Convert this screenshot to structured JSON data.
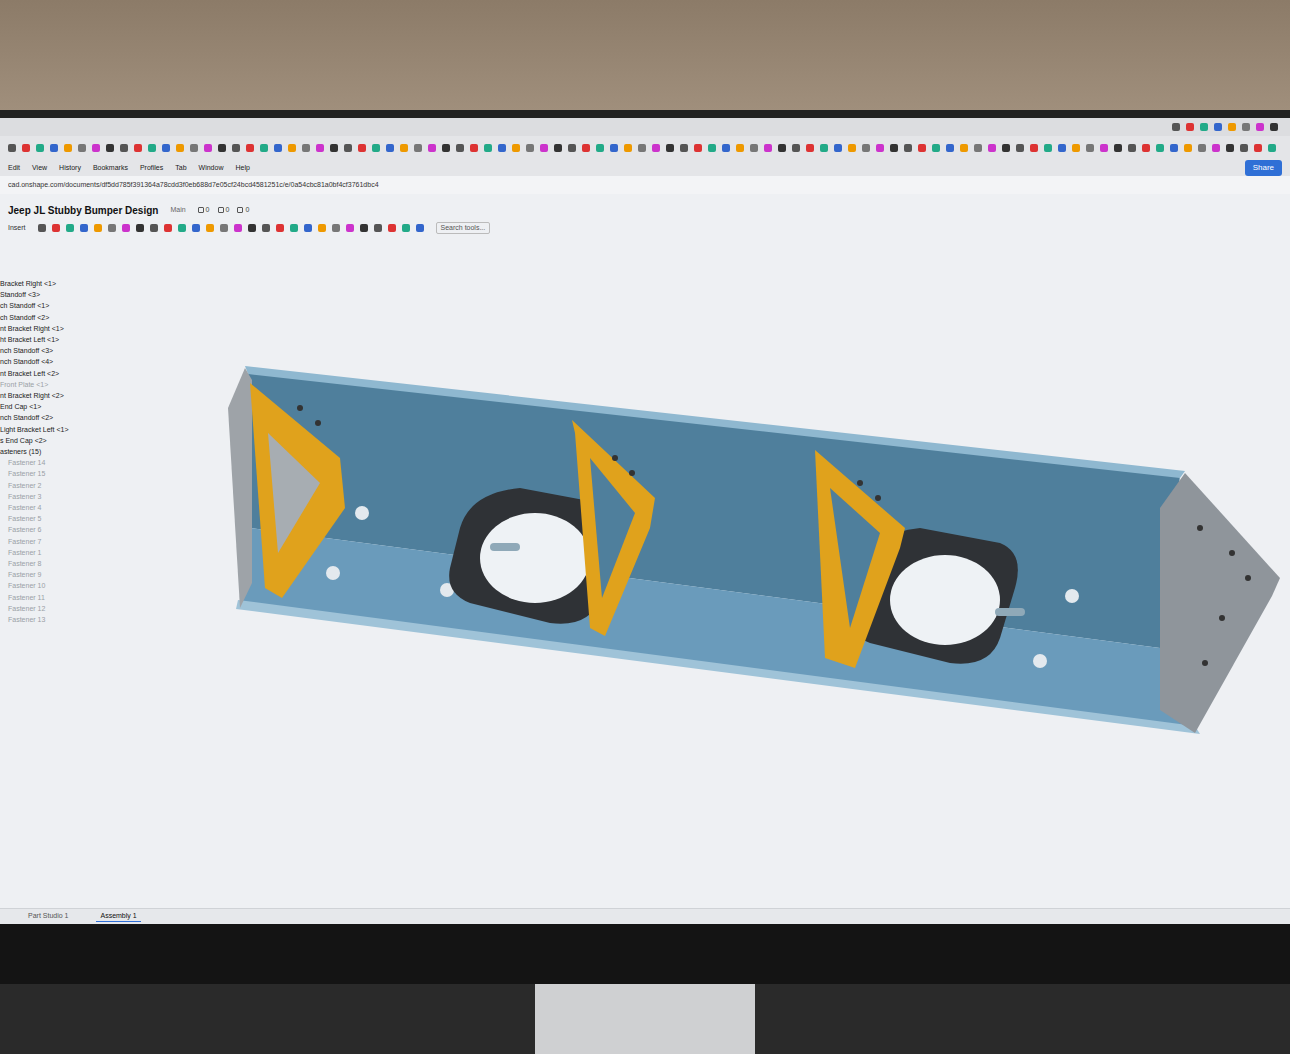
{
  "browser": {
    "menu": [
      "Edit",
      "View",
      "History",
      "Bookmarks",
      "Profiles",
      "Tab",
      "Window",
      "Help"
    ],
    "url": "cad.onshape.com/documents/df5dd785f391364a78cdd3f0eb688d7e05cf24bcd4581251c/e/0a54cbc81a0bf4cf3761dbc4"
  },
  "document": {
    "title": "Jeep JL Stubby Bumper Design",
    "branch": "Main",
    "counts": [
      "0",
      "0",
      "0"
    ]
  },
  "toolbar": {
    "insert": "Insert",
    "search_placeholder": "Search tools..."
  },
  "share": "Share",
  "features": [
    {
      "label": "Bracket Right <1>",
      "greyed": false,
      "kind": "instance"
    },
    {
      "label": "Standoff <3>",
      "greyed": false,
      "kind": "instance"
    },
    {
      "label": "ch Standoff <1>",
      "greyed": false,
      "kind": "instance"
    },
    {
      "label": "ch Standoff <2>",
      "greyed": false,
      "kind": "instance"
    },
    {
      "label": "nt Bracket Right <1>",
      "greyed": false,
      "kind": "instance"
    },
    {
      "label": "ht Bracket Left <1>",
      "greyed": false,
      "kind": "instance"
    },
    {
      "label": "nch Standoff <3>",
      "greyed": false,
      "kind": "instance"
    },
    {
      "label": "nch Standoff <4>",
      "greyed": false,
      "kind": "instance"
    },
    {
      "label": "nt Bracket Left <2>",
      "greyed": false,
      "kind": "instance"
    },
    {
      "label": "Front Plate <1>",
      "greyed": true,
      "kind": "instance"
    },
    {
      "label": "nt Bracket Right <2>",
      "greyed": false,
      "kind": "instance"
    },
    {
      "label": "End Cap <1>",
      "greyed": false,
      "kind": "instance"
    },
    {
      "label": "nch Standoff <2>",
      "greyed": false,
      "kind": "instance"
    },
    {
      "label": "Light Bracket Left <1>",
      "greyed": false,
      "kind": "instance"
    },
    {
      "label": "s End Cap <2>",
      "greyed": false,
      "kind": "instance"
    },
    {
      "label": "asteners (15)",
      "greyed": false,
      "kind": "folder"
    },
    {
      "label": "Fastener 14",
      "greyed": true,
      "kind": "fastener"
    },
    {
      "label": "Fastener 15",
      "greyed": true,
      "kind": "fastener"
    },
    {
      "label": "Fastener 2",
      "greyed": true,
      "kind": "fastener"
    },
    {
      "label": "Fastener 3",
      "greyed": true,
      "kind": "fastener"
    },
    {
      "label": "Fastener 4",
      "greyed": true,
      "kind": "fastener"
    },
    {
      "label": "Fastener 5",
      "greyed": true,
      "kind": "fastener"
    },
    {
      "label": "Fastener 6",
      "greyed": true,
      "kind": "fastener"
    },
    {
      "label": "Fastener 7",
      "greyed": true,
      "kind": "fastener"
    },
    {
      "label": "Fastener 1",
      "greyed": true,
      "kind": "fastener"
    },
    {
      "label": "Fastener 8",
      "greyed": true,
      "kind": "fastener"
    },
    {
      "label": "Fastener 9",
      "greyed": true,
      "kind": "fastener"
    },
    {
      "label": "Fastener 10",
      "greyed": true,
      "kind": "fastener"
    },
    {
      "label": "Fastener 11",
      "greyed": true,
      "kind": "fastener"
    },
    {
      "label": "Fastener 12",
      "greyed": true,
      "kind": "fastener"
    },
    {
      "label": "Fastener 13",
      "greyed": true,
      "kind": "fastener"
    }
  ],
  "tabs": [
    {
      "label": "Part Studio 1",
      "selected": false
    },
    {
      "label": "Assembly 1",
      "selected": true
    }
  ]
}
